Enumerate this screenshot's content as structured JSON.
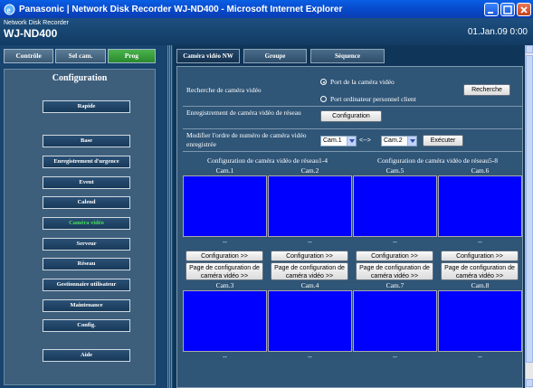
{
  "window": {
    "title": "Panasonic | Network Disk Recorder WJ-ND400 - Microsoft Internet Explorer"
  },
  "header": {
    "product": "Network Disk Recorder",
    "model": "WJ-ND400",
    "datetime": "01.Jan.09  0:00"
  },
  "modes": [
    "Contrôle",
    "Sel cam.",
    "Prog"
  ],
  "sidebar": {
    "title": "Configuration",
    "items": [
      {
        "label": "Rapide"
      },
      {
        "label": "Base"
      },
      {
        "label": "Enregistrement d'urgence"
      },
      {
        "label": "Event"
      },
      {
        "label": "Calend"
      },
      {
        "label": "Caméra vidéo"
      },
      {
        "label": "Serveur"
      },
      {
        "label": "Réseau"
      },
      {
        "label": "Gestionnaire utilisateur"
      },
      {
        "label": "Maintenance"
      },
      {
        "label": "Config."
      },
      {
        "label": "Aide"
      }
    ]
  },
  "tabs": [
    "Caméra vidéo NW",
    "Groupe",
    "Séquence"
  ],
  "search": {
    "label": "Recherche de caméra vidéo",
    "option1": "Port de la caméra vidéo",
    "option2": "Port ordinateur personnel client",
    "button": "Recherche"
  },
  "registration": {
    "label": "Enregistrement de caméra vidéo de réseau",
    "button": "Configuration"
  },
  "reorder": {
    "label": "Modifier l'ordre de numéro de caméra vidéo enregistrée",
    "from": "Cam.1",
    "arrow": "<-->",
    "to": "Cam.2",
    "button": "Exécuter"
  },
  "groups": [
    "Configuration de caméra vidéo de réseau1-4",
    "Configuration de caméra vidéo de réseau5-8"
  ],
  "cameras": [
    {
      "name": "Cam.1",
      "status": "--",
      "config_btn": "Configuration >>",
      "page_btn": "Page de configuration de caméra vidéo >>"
    },
    {
      "name": "Cam.2",
      "status": "--",
      "config_btn": "Configuration >>",
      "page_btn": "Page de configuration de caméra vidéo >>"
    },
    {
      "name": "Cam.5",
      "status": "--",
      "config_btn": "Configuration >>",
      "page_btn": "Page de configuration de caméra vidéo >>"
    },
    {
      "name": "Cam.6",
      "status": "--",
      "config_btn": "Configuration >>",
      "page_btn": "Page de configuration de caméra vidéo >>"
    },
    {
      "name": "Cam.3",
      "status": "--"
    },
    {
      "name": "Cam.4",
      "status": "--"
    },
    {
      "name": "Cam.7",
      "status": "--"
    },
    {
      "name": "Cam.8",
      "status": "--"
    }
  ],
  "colors": {
    "camera_view": "#0000ff",
    "active_mode": "#2a8a2d",
    "current_nav": "#47e05c"
  }
}
